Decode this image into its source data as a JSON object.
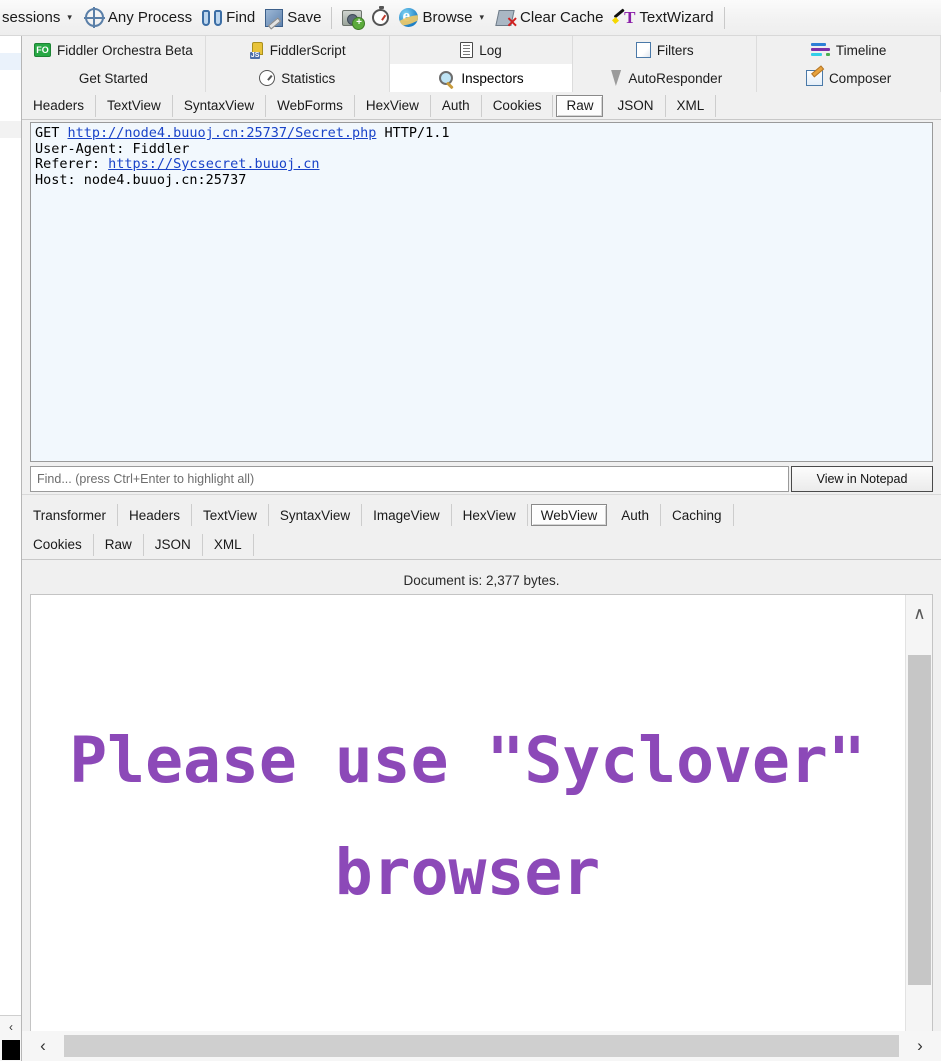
{
  "toolbar": {
    "sessions_label": "sessions",
    "any_process": "Any Process",
    "find": "Find",
    "save": "Save",
    "browse": "Browse",
    "clear_cache": "Clear Cache",
    "text_wizard": "TextWizard",
    "caret": "▾"
  },
  "main_tabs_row1": [
    {
      "label": "Fiddler Orchestra Beta",
      "icon": "fiddler-orchestra-icon",
      "active": false
    },
    {
      "label": "FiddlerScript",
      "icon": "fiddlerscript-icon",
      "active": false
    },
    {
      "label": "Log",
      "icon": "log-icon",
      "active": false
    },
    {
      "label": "Filters",
      "icon": "filters-icon",
      "active": false
    },
    {
      "label": "Timeline",
      "icon": "timeline-icon",
      "active": false
    }
  ],
  "main_tabs_row2": [
    {
      "label": "Get Started",
      "icon": "none",
      "active": false
    },
    {
      "label": "Statistics",
      "icon": "statistics-icon",
      "active": false
    },
    {
      "label": "Inspectors",
      "icon": "inspectors-icon",
      "active": true
    },
    {
      "label": "AutoResponder",
      "icon": "autoresponder-icon",
      "active": false
    },
    {
      "label": "Composer",
      "icon": "composer-icon",
      "active": false
    }
  ],
  "request_tabs": [
    {
      "label": "Headers",
      "selected": false
    },
    {
      "label": "TextView",
      "selected": false
    },
    {
      "label": "SyntaxView",
      "selected": false
    },
    {
      "label": "WebForms",
      "selected": false
    },
    {
      "label": "HexView",
      "selected": false
    },
    {
      "label": "Auth",
      "selected": false
    },
    {
      "label": "Cookies",
      "selected": false
    },
    {
      "label": "Raw",
      "selected": true
    },
    {
      "label": "JSON",
      "selected": false
    },
    {
      "label": "XML",
      "selected": false
    }
  ],
  "request_raw": {
    "line1_method": "GET ",
    "line1_url": "http://node4.buuoj.cn:25737/Secret.php",
    "line1_version": " HTTP/1.1",
    "line2": "User-Agent: Fiddler",
    "line3_label": "Referer: ",
    "line3_url": "https://Sycsecret.buuoj.cn",
    "line4": "Host: node4.buuoj.cn:25737"
  },
  "find_bar": {
    "placeholder": "Find... (press Ctrl+Enter to highlight all)",
    "value": "",
    "notepad_button": "View in Notepad"
  },
  "response_tabs_row1": [
    {
      "label": "Transformer",
      "selected": false
    },
    {
      "label": "Headers",
      "selected": false
    },
    {
      "label": "TextView",
      "selected": false
    },
    {
      "label": "SyntaxView",
      "selected": false
    },
    {
      "label": "ImageView",
      "selected": false
    },
    {
      "label": "HexView",
      "selected": false
    },
    {
      "label": "WebView",
      "selected": true
    },
    {
      "label": "Auth",
      "selected": false
    },
    {
      "label": "Caching",
      "selected": false
    }
  ],
  "response_tabs_row2": [
    {
      "label": "Cookies",
      "selected": false
    },
    {
      "label": "Raw",
      "selected": false
    },
    {
      "label": "JSON",
      "selected": false
    },
    {
      "label": "XML",
      "selected": false
    }
  ],
  "document_size": "Document is: 2,377 bytes.",
  "webview": {
    "line1": "Please use \"Syclover\"",
    "line2": "browser",
    "text_color": "#8c49b8"
  },
  "scrollbars": {
    "up_arrow": "∧",
    "down_arrow": "∨",
    "left_arrow": "‹",
    "right_arrow": "›"
  },
  "session_rows": [
    {
      "text": "",
      "state": "normal"
    },
    {
      "text": "",
      "state": "selected"
    },
    {
      "text": "",
      "state": "normal"
    },
    {
      "text": "",
      "state": "normal"
    },
    {
      "text": "",
      "state": "normal"
    },
    {
      "text": "",
      "state": "gray"
    }
  ]
}
